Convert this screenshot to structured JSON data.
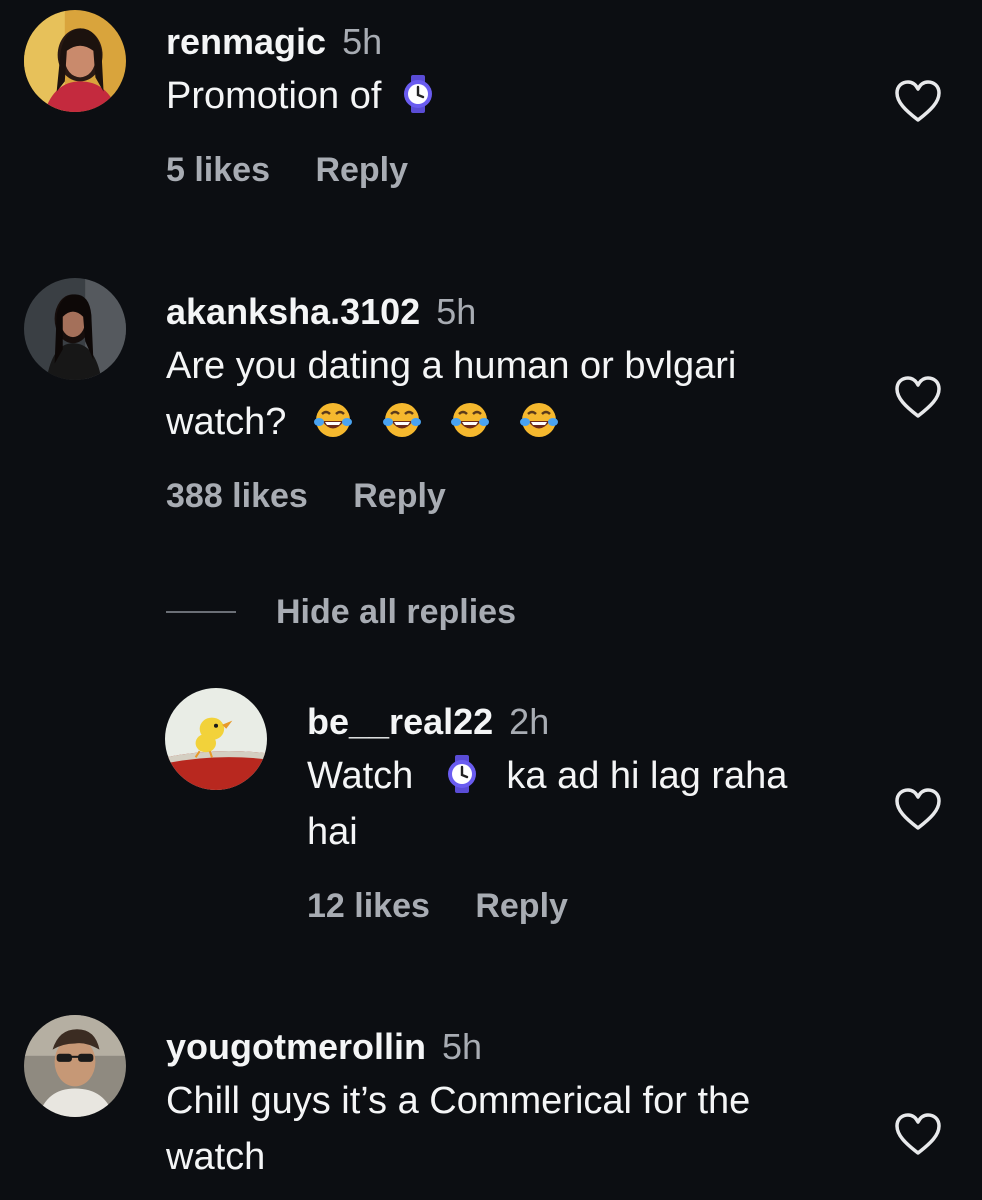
{
  "comments": [
    {
      "username": "renmagic",
      "time": "5h",
      "text_before": "Promotion of",
      "emoji": "watch-emoji",
      "likes": "5 likes",
      "reply": "Reply"
    },
    {
      "username": "akanksha.3102",
      "time": "5h",
      "text_line1": "Are you dating a human or bvlgari",
      "text_line2": "watch?",
      "emoji": "face-with-tears-of-joy-emoji",
      "likes": "388 likes",
      "reply": "Reply"
    },
    {
      "username": "yougotmerollin",
      "time": "5h",
      "text_line1": "Chill guys it’s a Commerical for the",
      "text_line2": "watch"
    }
  ],
  "thread": {
    "hide_replies": "Hide all replies"
  },
  "replies": [
    {
      "username": "be__real22",
      "time": "2h",
      "text_before": "Watch",
      "emoji": "watch-emoji",
      "text_after": "ka ad hi lag raha",
      "text_line2": "hai",
      "likes": "12 likes",
      "reply": "Reply"
    }
  ],
  "colors": {
    "background": "#0c0e12",
    "primary_text": "#f4f5f6",
    "secondary_text": "#a8acb3",
    "watch_emoji": "#6a5cf0"
  },
  "icons": {
    "like": "heart-outline-icon"
  }
}
